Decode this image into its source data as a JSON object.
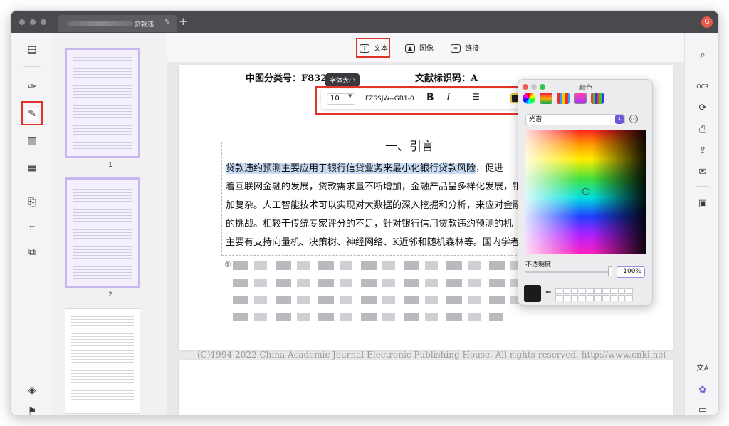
{
  "window": {
    "tab_title": "贷款违",
    "tab_edit_icon": "pencil-icon",
    "add_tab": "+",
    "avatar_letter": "G"
  },
  "toolbar_top": {
    "text_label": "文本",
    "image_label": "图像",
    "link_label": "链接"
  },
  "font_toolbar": {
    "tooltip": "字体大小",
    "font_size": "10",
    "font_name": "FZSSJW--GB1-0",
    "bold": "B",
    "italic": "I"
  },
  "document": {
    "class_no": "中图分类号：F832.",
    "doc_code": "文献标识码：A",
    "heading": "一、引言",
    "para_lines": [
      "贷款违约预测主要应用于银行信贷业务来最小化银行贷款风险",
      "着互联网金融的发展，贷款需求量不断增加，金融产品呈多样化发展，银",
      "加复杂。人工智能技术可以实现对大数据的深入挖掘和分析，来应对金融",
      "的挑战。相较于传统专家评分的不足，针对银行信用贷款违约预测的机",
      "主要有支持向量机、决策树、神经网络、K近邻和随机森林等。国内学者"
    ],
    "para_first_suffix": "，促进",
    "footnote_mark": "①",
    "footer": "(C)1994-2022 China Academic Journal Electronic Publishing House. All rights reserved.    http://www.cnki.net"
  },
  "thumbnails": {
    "page1": "1",
    "page2": "2"
  },
  "color_panel": {
    "title": "颜色",
    "mode": "光谱",
    "opacity_label": "不透明度",
    "opacity_value": "100%",
    "opacity": 1.0,
    "selected_color": "#1b1b1b"
  },
  "colors": {
    "accent_red": "#e0332a",
    "accent_purple": "#6b5bd4",
    "highlight": "#c9dcf6"
  }
}
